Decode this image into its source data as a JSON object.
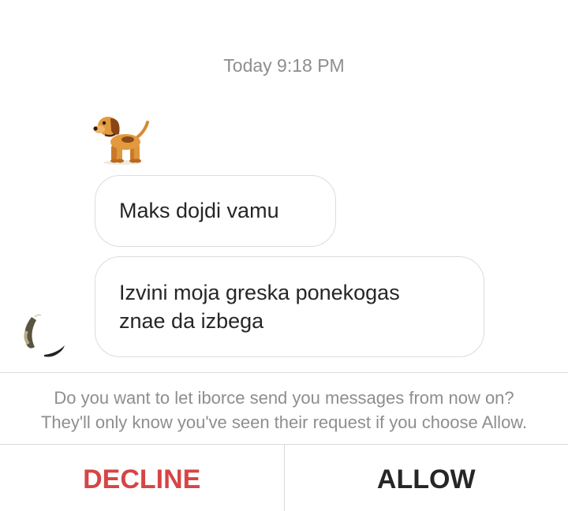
{
  "thread": {
    "timestamp": "Today 9:18 PM",
    "sticker_icon": "dog-emoji-icon",
    "messages": [
      {
        "lines": [
          "Maks dojdi vamu"
        ]
      },
      {
        "lines": [
          "Izvini moja greska ponekogas",
          "znae da izbega"
        ]
      }
    ],
    "avatar_icon": "sender-avatar"
  },
  "request": {
    "line1": "Do you want to let iborce send you messages from now on?",
    "line2": "They'll only know you've seen their request if you choose Allow.",
    "decline_label": "DECLINE",
    "allow_label": "ALLOW"
  },
  "colors": {
    "decline": "#d64545",
    "allow": "#262626",
    "muted_text": "#8e8e8e",
    "bubble_border": "#dcdcdc"
  }
}
